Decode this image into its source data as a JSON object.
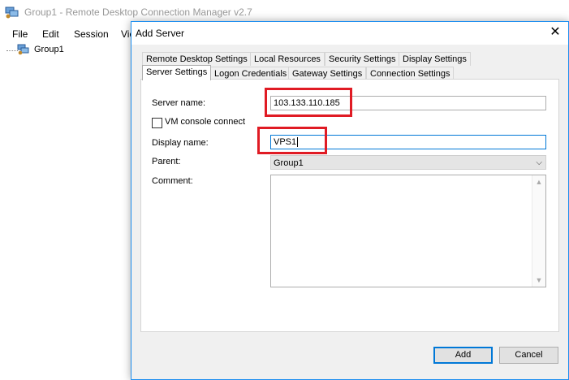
{
  "main_window": {
    "title": "Group1 - Remote Desktop Connection Manager v2.7",
    "menu": [
      "File",
      "Edit",
      "Session",
      "Vie"
    ],
    "tree": {
      "root_label": "Group1"
    }
  },
  "dialog": {
    "title": "Add Server",
    "tabs_row1": [
      "Remote Desktop Settings",
      "Local Resources",
      "Security Settings",
      "Display Settings"
    ],
    "tabs_row2": [
      "Server Settings",
      "Logon Credentials",
      "Gateway Settings",
      "Connection Settings"
    ],
    "active_tab": "Server Settings",
    "form": {
      "server_name_label": "Server name:",
      "server_name_value": "103.133.110.185",
      "vm_console_label": "VM console connect",
      "vm_console_checked": false,
      "display_name_label": "Display name:",
      "display_name_value": "VPS1",
      "parent_label": "Parent:",
      "parent_value": "Group1",
      "comment_label": "Comment:",
      "comment_value": ""
    },
    "buttons": {
      "add": "Add",
      "cancel": "Cancel"
    },
    "highlight_color": "#e01b24"
  }
}
